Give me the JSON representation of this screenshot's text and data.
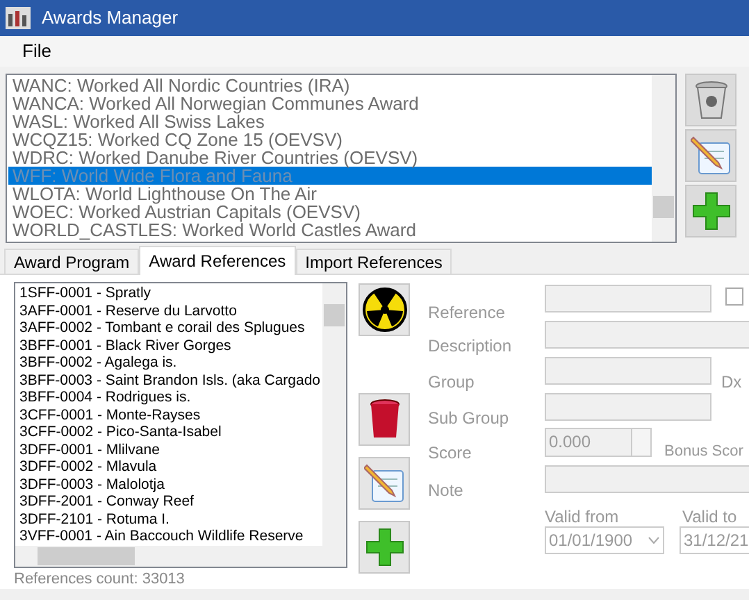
{
  "window": {
    "title": "Awards Manager"
  },
  "menu": [
    "File"
  ],
  "awards": [
    {
      "label": "WANC: Worked All Nordic Countries (IRA)",
      "selected": false
    },
    {
      "label": "WANCA: Worked All Norwegian Communes Award",
      "selected": false
    },
    {
      "label": "WASL: Worked All Swiss Lakes",
      "selected": false
    },
    {
      "label": "WCQZ15: Worked CQ Zone 15 (OEVSV)",
      "selected": false
    },
    {
      "label": "WDRC: Worked Danube River Countries (OEVSV)",
      "selected": false
    },
    {
      "label": "WFF: World Wide Flora and Fauna",
      "selected": true
    },
    {
      "label": "WLOTA: World Lighthouse On The Air",
      "selected": false
    },
    {
      "label": "WOEC: Worked Austrian Capitals (OEVSV)",
      "selected": false
    },
    {
      "label": "WORLD_CASTLES: Worked World Castles Award",
      "selected": false
    }
  ],
  "tabs": [
    {
      "label": "Award Program",
      "selected": false
    },
    {
      "label": "Award References",
      "selected": true
    },
    {
      "label": "Import References",
      "selected": false
    }
  ],
  "references": [
    "1SFF-0001 - Spratly",
    "3AFF-0001 - Reserve du Larvotto",
    "3AFF-0002 - Tombant e corail des Splugues",
    "3BFF-0001 - Black River Gorges",
    "3BFF-0002 - Agalega is.",
    "3BFF-0003 - Saint Brandon Isls. (aka Cargado",
    "3BFF-0004 - Rodrigues is.",
    "3CFF-0001 - Monte-Rayses",
    "3CFF-0002 - Pico-Santa-Isabel",
    "3DFF-0001 - Mlilvane",
    "3DFF-0002 - Mlavula",
    "3DFF-0003 - Malolotja",
    "3DFF-2001 - Conway Reef",
    "3DFF-2101 - Rotuma I.",
    "3VFF-0001 - Ain Baccouch Wildlife Reserve"
  ],
  "reference_count": "References count: 33013",
  "form": {
    "reference": "Reference",
    "description": "Description",
    "group": "Group",
    "dx": "Dx",
    "checked": false,
    "sub_group": "Sub Group",
    "score": {
      "label": "Score",
      "value": "0.000"
    },
    "bonus_score": "Bonus Scor",
    "note": "Note",
    "valid_from": {
      "label": "Valid from",
      "value": "01/01/1900"
    },
    "valid_to": {
      "label": "Valid to",
      "value": "31/12/21"
    }
  }
}
